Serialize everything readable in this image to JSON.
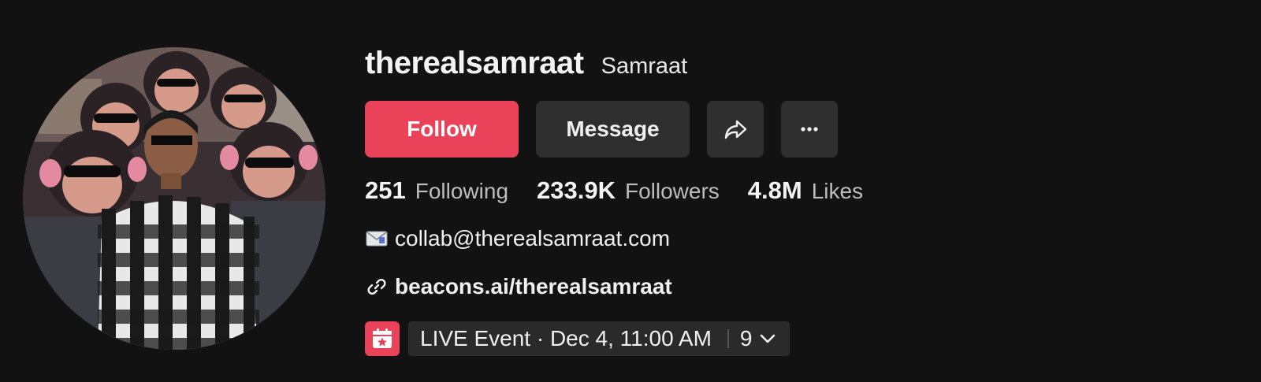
{
  "profile": {
    "username": "therealsamraat",
    "nickname": "Samraat"
  },
  "actions": {
    "follow_label": "Follow",
    "message_label": "Message",
    "share_icon": "share-arrow-icon",
    "more_icon": "more-dots-icon"
  },
  "stats": {
    "following_count": "251",
    "following_label": "Following",
    "followers_count": "233.9K",
    "followers_label": "Followers",
    "likes_count": "4.8M",
    "likes_label": "Likes"
  },
  "bio": {
    "email_icon": "envelope-icon",
    "email": "collab@therealsamraat.com",
    "link_icon": "link-icon",
    "link": "beacons.ai/therealsamraat"
  },
  "event": {
    "icon": "calendar-star-icon",
    "label": "LIVE Event · Dec 4, 11:00 AM",
    "count": "9"
  },
  "colors": {
    "background": "#121212",
    "accent": "#ea4359",
    "button_secondary": "#2f2f2f"
  }
}
